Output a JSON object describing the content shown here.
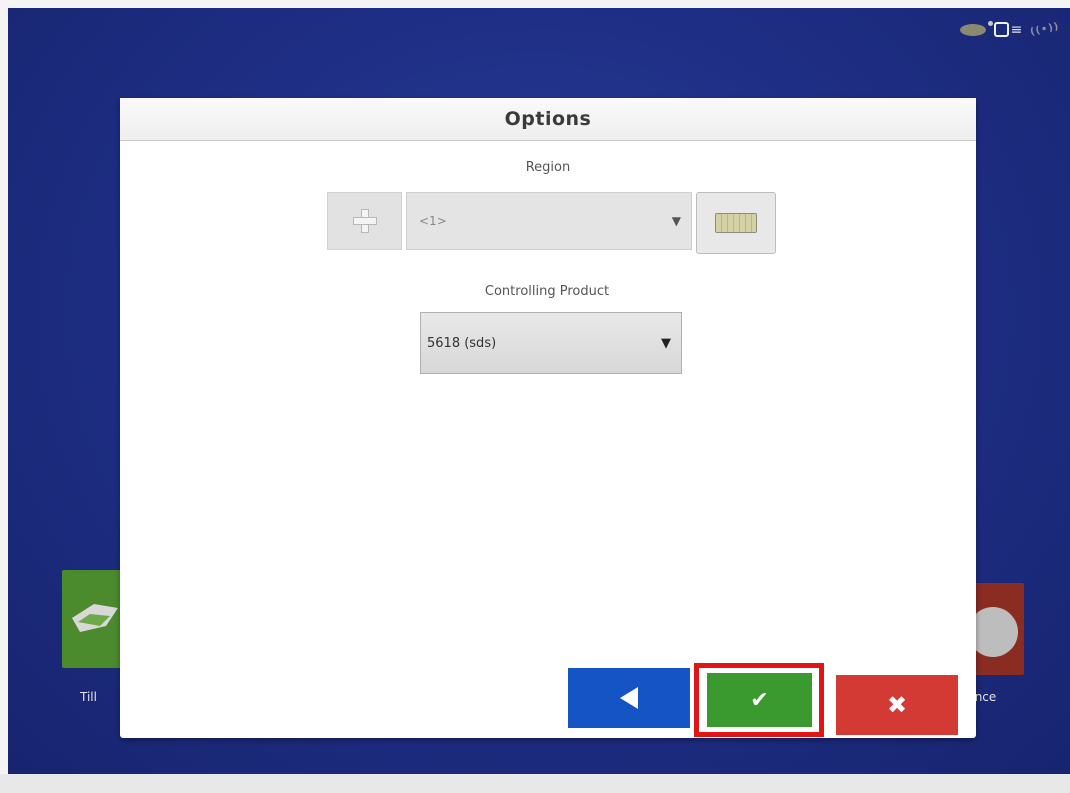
{
  "dialog": {
    "title": "Options"
  },
  "region": {
    "label": "Region",
    "value": "<1>",
    "arrow": "▼"
  },
  "product": {
    "label": "Controlling Product",
    "value": "5618 (sds)",
    "arrow": "▼"
  },
  "buttons": {
    "back_icon": "back-arrow-icon",
    "accept_glyph": "✔",
    "cancel_glyph": "✖"
  },
  "background_tiles": {
    "left_label": "Till",
    "right_label": "lance"
  },
  "colors": {
    "screen_bg": "#1f2f86",
    "back_button": "#1554c4",
    "accept_button": "#3b9a2f",
    "cancel_button": "#d23a33",
    "highlight": "#e01515"
  }
}
